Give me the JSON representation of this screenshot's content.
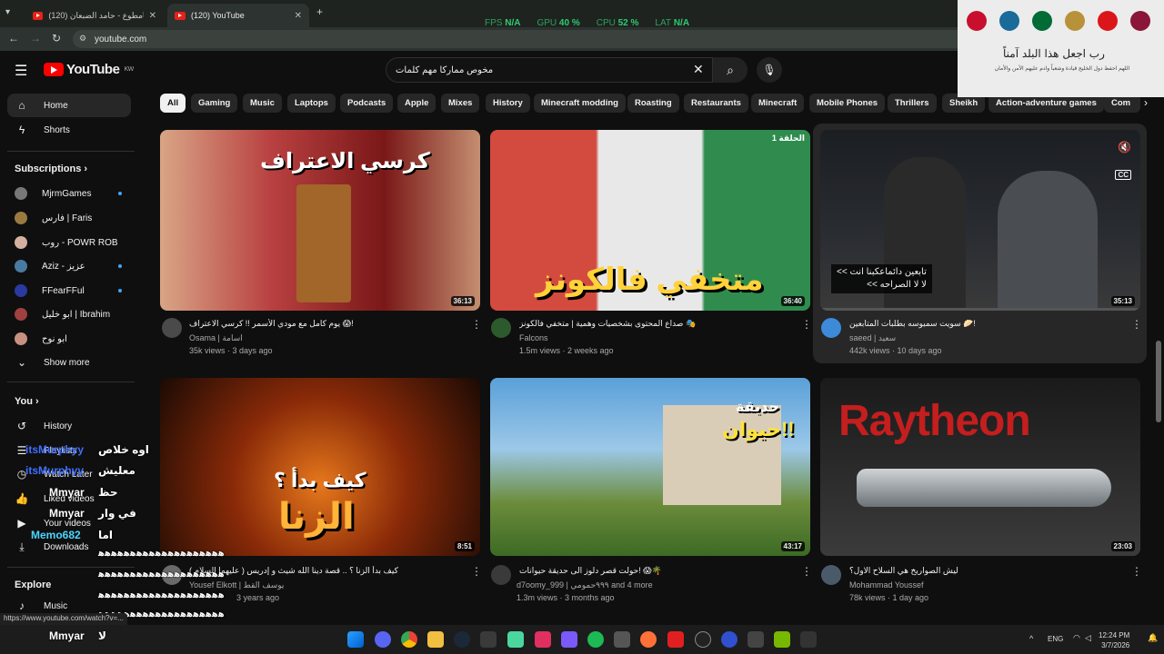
{
  "browser": {
    "tabs": [
      {
        "label": "(120) يامطوع - حامد الضبعان"
      },
      {
        "label": "(120) YouTube"
      }
    ],
    "new_tab": "+",
    "url": "youtube.com",
    "status_url": "https://www.youtube.com/watch?v=..."
  },
  "perf": {
    "fps_label": "FPS",
    "fps": "N/A",
    "gpu_label": "GPU",
    "gpu": "40 %",
    "cpu_label": "CPU",
    "cpu": "52 %",
    "lat_label": "LAT",
    "lat": "N/A"
  },
  "youtube": {
    "logo": "YouTube",
    "region": "KW",
    "search_query": "مخوص ممارکا مهم کلمات"
  },
  "sidebar": {
    "home": "Home",
    "shorts": "Shorts",
    "subscriptions": "Subscriptions",
    "subs": [
      {
        "label": "MjrmGames",
        "color": "#777777"
      },
      {
        "label": "فارس | Faris",
        "color": "#9a7a40"
      },
      {
        "label": "روب - POWR ROB",
        "color": "#d5b0a0"
      },
      {
        "label": "Aziz - عزيز",
        "color": "#4a7aa0"
      },
      {
        "label": "FFearFFul",
        "color": "#2a3aa0"
      },
      {
        "label": "ابو خليل | Ibrahim",
        "color": "#a04040"
      },
      {
        "label": "ابو نوح",
        "color": "#c89080"
      }
    ],
    "show_more": "Show more",
    "you": "You",
    "history": "History",
    "playlists": "Playlists",
    "watch_later": "Watch Later",
    "liked": "Liked videos",
    "your_videos": "Your videos",
    "downloads": "Downloads",
    "explore": "Explore",
    "music": "Music"
  },
  "chips": [
    "All",
    "Gaming",
    "Music",
    "Laptops",
    "Podcasts",
    "Apple",
    "Mixes",
    "History",
    "Minecraft modding",
    "Roasting",
    "Restaurants",
    "Minecraft",
    "Mobile Phones",
    "Thrillers",
    "Sheikh",
    "Action-adventure games",
    "Com"
  ],
  "videos": [
    {
      "title": "يوم كامل مع مودي الأسمر !! كرسي الاعتراف 😱!",
      "channel": "Osama | اسامة",
      "meta": "35k views · 3 days ago",
      "duration": "36:13",
      "art": "كرسي الاعتراف"
    },
    {
      "title": "صداع المحتوى بشخصيات وهمية | متخفي فالكونز 🎭",
      "channel": "Falcons",
      "meta": "1.5m views · 2 weeks ago",
      "duration": "36:40",
      "art": "متخفي فالكونز",
      "badge": "الحلقة 1"
    },
    {
      "title": "سويت سمبوسه بطلبات المتابعين 🥟!",
      "channel": "saeed | سعيد",
      "meta": "442k views · 10 days ago",
      "duration": "35:13",
      "caption1": "<< تابعين دائماعكبنا انت",
      "caption2": "<< لا لا الصراحه",
      "cc": "CC"
    },
    {
      "title": "كيف بدأ الزنا ؟ .. قصة دينا الله شيث و إدريس ( عليهما السلام )",
      "channel": "Yousef Elkott | يوسف القط",
      "meta": "3 years ago",
      "duration": "8:51",
      "art1": "كيف بدأ ؟",
      "art2": "الزنا"
    },
    {
      "title": "حولت قصر دلوز الى حديقة حيوانات! 😱🌴",
      "channel": "d7oomy_999 | ٩٩٩حمومي and 4 more",
      "meta": "1.3m views · 3 months ago",
      "duration": "43:17",
      "art1": "حديقة",
      "art2": "حيوان!!"
    },
    {
      "title": "ليش الصواريخ هي السلاح الاول؟",
      "channel": "Mohammad Youssef",
      "meta": "78k views · 1 day ago",
      "duration": "23:03",
      "art": "Raytheon"
    }
  ],
  "chat": [
    {
      "name": "itsMurphyy",
      "msg": "اوه خلاص"
    },
    {
      "name": "itsMurphyy",
      "msg": "معليش"
    },
    {
      "name": "Mmyar",
      "msg": "حظ"
    },
    {
      "name": "Mmyar",
      "msg": "في وار"
    },
    {
      "name": "Memo682",
      "msg": "اما"
    },
    {
      "name": "Mmyar",
      "msg": "لا"
    }
  ],
  "chat_spam": "ﻫﻫﻫﻫﻫﻫﻫﻫﻫﻫﻫﻫﻫﻫﻫﻫﻫﻫﻫﻫ",
  "cam": {
    "line1": "رب اجعل هذا البلد آمناً",
    "line2": "اللهم احفظ دول الخليج قيادة وشعباً وادم عليهم الأمن والأمان"
  },
  "taskbar": {
    "lang": "ENG",
    "time": "12:24 PM",
    "date": "3/7/2026"
  }
}
